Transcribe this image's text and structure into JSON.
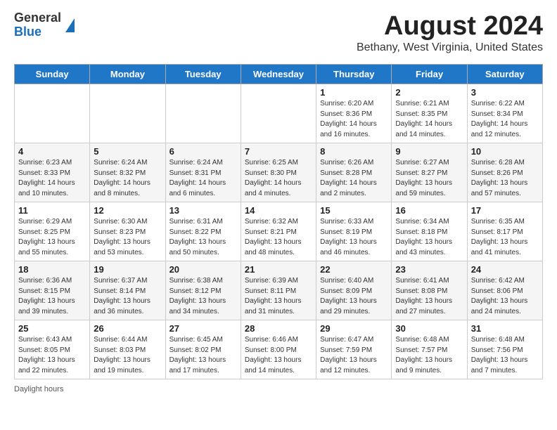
{
  "header": {
    "logo_general": "General",
    "logo_blue": "Blue",
    "month_title": "August 2024",
    "subtitle": "Bethany, West Virginia, United States"
  },
  "days_of_week": [
    "Sunday",
    "Monday",
    "Tuesday",
    "Wednesday",
    "Thursday",
    "Friday",
    "Saturday"
  ],
  "weeks": [
    [
      {
        "day": "",
        "info": ""
      },
      {
        "day": "",
        "info": ""
      },
      {
        "day": "",
        "info": ""
      },
      {
        "day": "",
        "info": ""
      },
      {
        "day": "1",
        "info": "Sunrise: 6:20 AM\nSunset: 8:36 PM\nDaylight: 14 hours\nand 16 minutes."
      },
      {
        "day": "2",
        "info": "Sunrise: 6:21 AM\nSunset: 8:35 PM\nDaylight: 14 hours\nand 14 minutes."
      },
      {
        "day": "3",
        "info": "Sunrise: 6:22 AM\nSunset: 8:34 PM\nDaylight: 14 hours\nand 12 minutes."
      }
    ],
    [
      {
        "day": "4",
        "info": "Sunrise: 6:23 AM\nSunset: 8:33 PM\nDaylight: 14 hours\nand 10 minutes."
      },
      {
        "day": "5",
        "info": "Sunrise: 6:24 AM\nSunset: 8:32 PM\nDaylight: 14 hours\nand 8 minutes."
      },
      {
        "day": "6",
        "info": "Sunrise: 6:24 AM\nSunset: 8:31 PM\nDaylight: 14 hours\nand 6 minutes."
      },
      {
        "day": "7",
        "info": "Sunrise: 6:25 AM\nSunset: 8:30 PM\nDaylight: 14 hours\nand 4 minutes."
      },
      {
        "day": "8",
        "info": "Sunrise: 6:26 AM\nSunset: 8:28 PM\nDaylight: 14 hours\nand 2 minutes."
      },
      {
        "day": "9",
        "info": "Sunrise: 6:27 AM\nSunset: 8:27 PM\nDaylight: 13 hours\nand 59 minutes."
      },
      {
        "day": "10",
        "info": "Sunrise: 6:28 AM\nSunset: 8:26 PM\nDaylight: 13 hours\nand 57 minutes."
      }
    ],
    [
      {
        "day": "11",
        "info": "Sunrise: 6:29 AM\nSunset: 8:25 PM\nDaylight: 13 hours\nand 55 minutes."
      },
      {
        "day": "12",
        "info": "Sunrise: 6:30 AM\nSunset: 8:23 PM\nDaylight: 13 hours\nand 53 minutes."
      },
      {
        "day": "13",
        "info": "Sunrise: 6:31 AM\nSunset: 8:22 PM\nDaylight: 13 hours\nand 50 minutes."
      },
      {
        "day": "14",
        "info": "Sunrise: 6:32 AM\nSunset: 8:21 PM\nDaylight: 13 hours\nand 48 minutes."
      },
      {
        "day": "15",
        "info": "Sunrise: 6:33 AM\nSunset: 8:19 PM\nDaylight: 13 hours\nand 46 minutes."
      },
      {
        "day": "16",
        "info": "Sunrise: 6:34 AM\nSunset: 8:18 PM\nDaylight: 13 hours\nand 43 minutes."
      },
      {
        "day": "17",
        "info": "Sunrise: 6:35 AM\nSunset: 8:17 PM\nDaylight: 13 hours\nand 41 minutes."
      }
    ],
    [
      {
        "day": "18",
        "info": "Sunrise: 6:36 AM\nSunset: 8:15 PM\nDaylight: 13 hours\nand 39 minutes."
      },
      {
        "day": "19",
        "info": "Sunrise: 6:37 AM\nSunset: 8:14 PM\nDaylight: 13 hours\nand 36 minutes."
      },
      {
        "day": "20",
        "info": "Sunrise: 6:38 AM\nSunset: 8:12 PM\nDaylight: 13 hours\nand 34 minutes."
      },
      {
        "day": "21",
        "info": "Sunrise: 6:39 AM\nSunset: 8:11 PM\nDaylight: 13 hours\nand 31 minutes."
      },
      {
        "day": "22",
        "info": "Sunrise: 6:40 AM\nSunset: 8:09 PM\nDaylight: 13 hours\nand 29 minutes."
      },
      {
        "day": "23",
        "info": "Sunrise: 6:41 AM\nSunset: 8:08 PM\nDaylight: 13 hours\nand 27 minutes."
      },
      {
        "day": "24",
        "info": "Sunrise: 6:42 AM\nSunset: 8:06 PM\nDaylight: 13 hours\nand 24 minutes."
      }
    ],
    [
      {
        "day": "25",
        "info": "Sunrise: 6:43 AM\nSunset: 8:05 PM\nDaylight: 13 hours\nand 22 minutes."
      },
      {
        "day": "26",
        "info": "Sunrise: 6:44 AM\nSunset: 8:03 PM\nDaylight: 13 hours\nand 19 minutes."
      },
      {
        "day": "27",
        "info": "Sunrise: 6:45 AM\nSunset: 8:02 PM\nDaylight: 13 hours\nand 17 minutes."
      },
      {
        "day": "28",
        "info": "Sunrise: 6:46 AM\nSunset: 8:00 PM\nDaylight: 13 hours\nand 14 minutes."
      },
      {
        "day": "29",
        "info": "Sunrise: 6:47 AM\nSunset: 7:59 PM\nDaylight: 13 hours\nand 12 minutes."
      },
      {
        "day": "30",
        "info": "Sunrise: 6:48 AM\nSunset: 7:57 PM\nDaylight: 13 hours\nand 9 minutes."
      },
      {
        "day": "31",
        "info": "Sunrise: 6:48 AM\nSunset: 7:56 PM\nDaylight: 13 hours\nand 7 minutes."
      }
    ]
  ],
  "footer": {
    "daylight_hours": "Daylight hours"
  }
}
